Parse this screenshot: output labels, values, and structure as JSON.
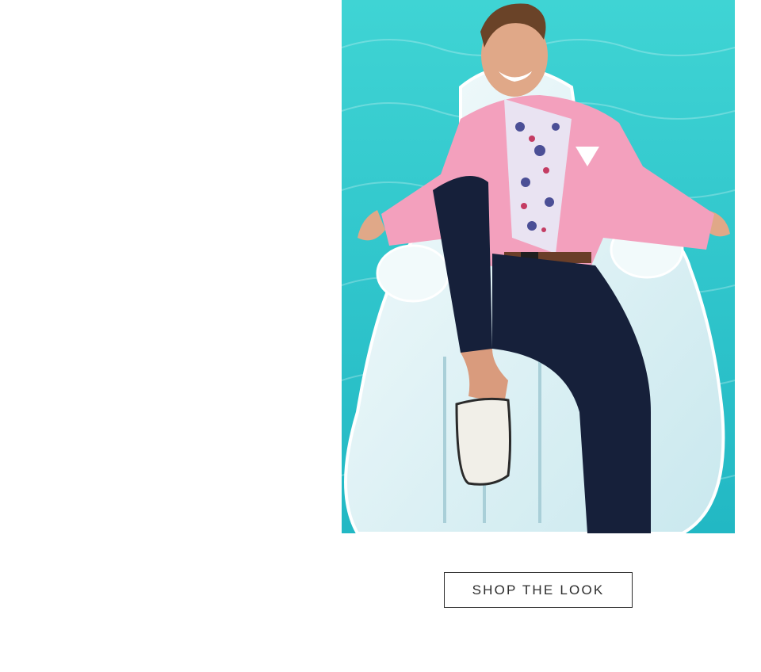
{
  "cta": {
    "label": "SHOP THE LOOK"
  },
  "colors": {
    "pool": "#2ec9cd",
    "jacket": "#f3a0bd",
    "pants": "#16203a",
    "float": "#dff1f4",
    "button_border": "#2c2c2c"
  }
}
